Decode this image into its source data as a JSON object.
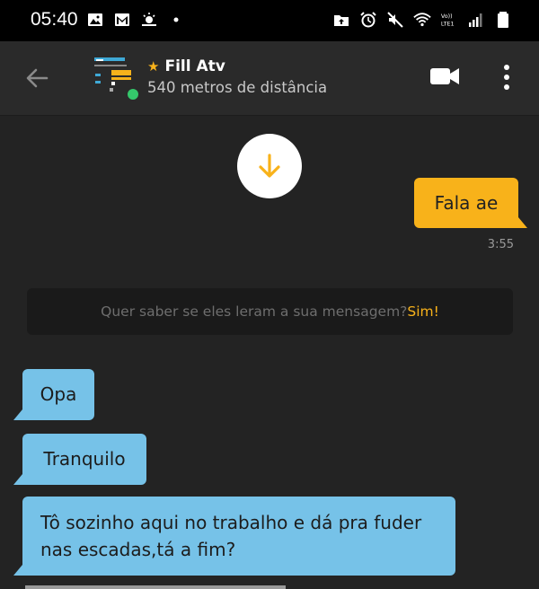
{
  "status_bar": {
    "time": "05:40",
    "left_icons": [
      "image-icon",
      "mail-icon",
      "weather-icon",
      "dot-icon"
    ],
    "right_icons": [
      "upload-icon",
      "alarm-icon",
      "mute-icon",
      "wifi-icon",
      "volte-icon",
      "signal-icon",
      "battery-icon"
    ],
    "volte_label": "Vo)) LTE1"
  },
  "header": {
    "name": "Fill Atv",
    "distance": "540 metros de distância",
    "online": true,
    "accent": "#f7b21b",
    "online_color": "#35c76b"
  },
  "messages": {
    "outgoing": [
      {
        "text": "Fala ae",
        "time": "3:55"
      }
    ],
    "receipt_prompt": "Quer saber se eles leram a sua mensagem?",
    "receipt_link": "Sim!",
    "incoming": [
      {
        "text": "Opa"
      },
      {
        "text": "Tranquilo"
      },
      {
        "text": "Tô sozinho aqui no trabalho e dá pra fuder nas escadas,tá a fim?"
      }
    ]
  },
  "colors": {
    "outgoing_bubble": "#f8b21a",
    "incoming_bubble": "#76c2e8",
    "background": "#232323",
    "header": "#2a2a2a"
  }
}
